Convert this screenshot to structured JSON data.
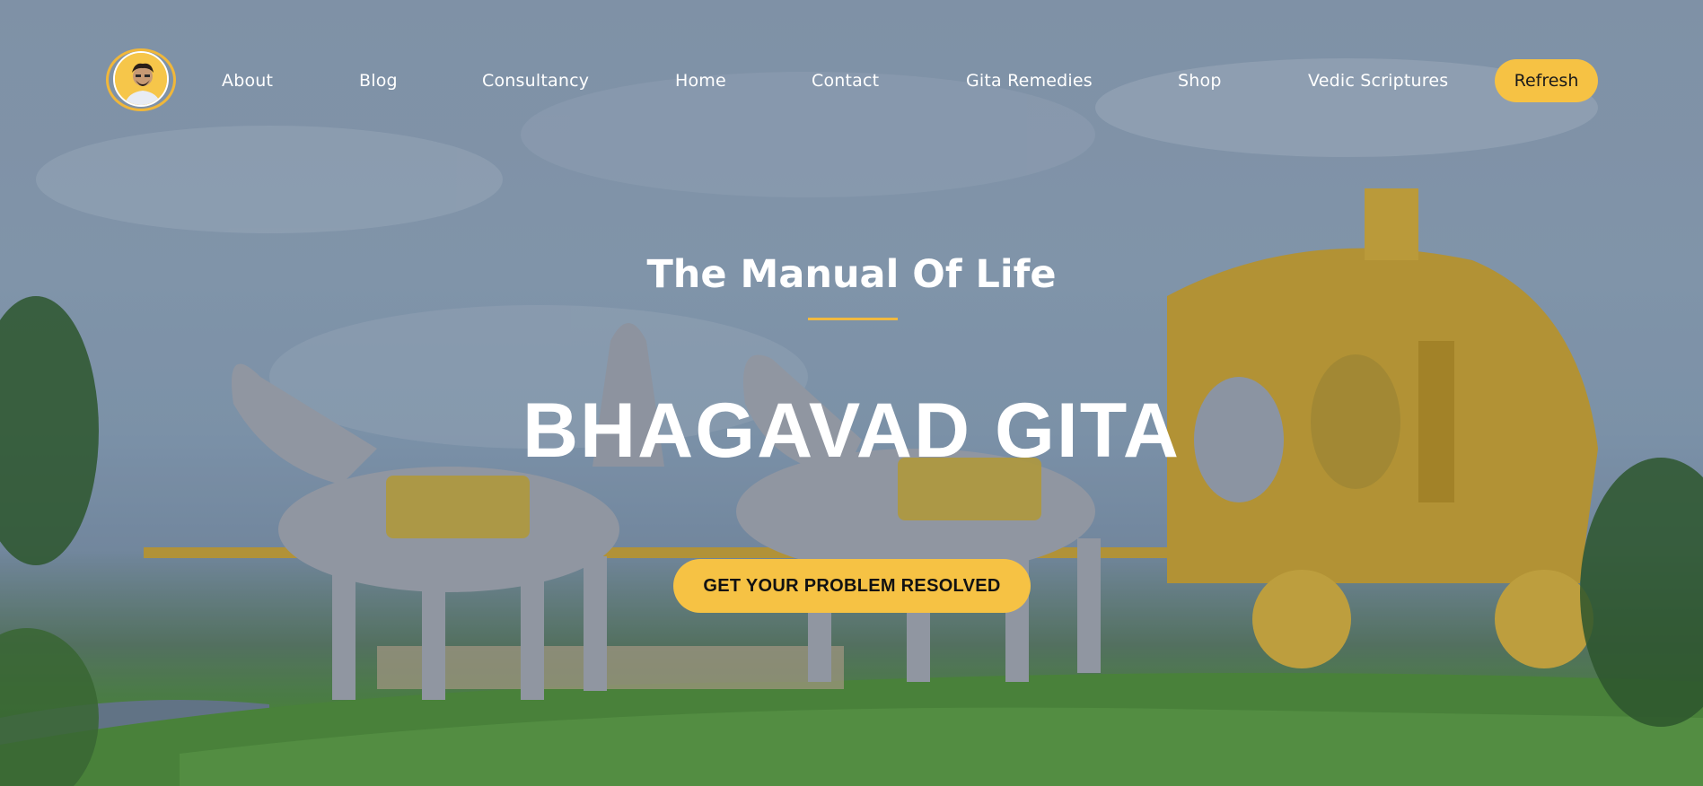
{
  "nav": {
    "logo_icon": "profile-avatar-icon",
    "items": [
      {
        "label": "About"
      },
      {
        "label": "Blog"
      },
      {
        "label": "Consultancy"
      },
      {
        "label": "Home"
      },
      {
        "label": "Contact"
      },
      {
        "label": "Gita Remedies"
      },
      {
        "label": "Shop"
      },
      {
        "label": "Vedic Scriptures"
      }
    ],
    "refresh_label": "Refresh"
  },
  "hero": {
    "tagline": "The Manual Of Life",
    "headline": "BHAGAVAD GITA",
    "cta_label": "GET YOUR PROBLEM RESOLVED"
  },
  "colors": {
    "accent": "#f6c244",
    "text": "#ffffff",
    "button_text": "#121212"
  }
}
